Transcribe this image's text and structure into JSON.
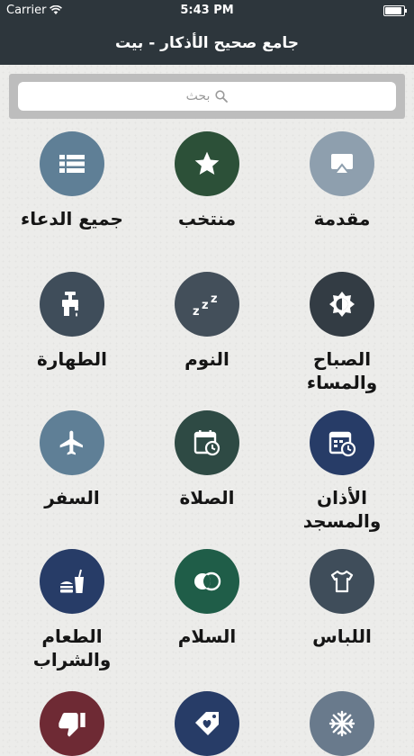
{
  "status_bar": {
    "carrier": "Carrier",
    "time": "5:43 PM",
    "battery_level": 1.0
  },
  "nav": {
    "title": "جامع صحيح الأذكار - بيت"
  },
  "search": {
    "placeholder": "بحث",
    "icon": "search-icon"
  },
  "colors": {
    "header": "#2d363c",
    "slate_light": "#5f7f96",
    "slate": "#3f4d5a",
    "green": "#2c5038",
    "navy": "#273c67",
    "teal_green": "#1f5d48",
    "maroon": "#6e2a34",
    "steel": "#697a8c"
  },
  "tiles": [
    {
      "label": "مقدمة",
      "icon": "airplay-icon",
      "color": "#8e9fae"
    },
    {
      "label": "منتخب",
      "icon": "star-icon",
      "color": "#2c5038"
    },
    {
      "label": "جميع الدعاء",
      "icon": "list-icon",
      "color": "#5f7f96"
    },
    {
      "label": "الصباح والمساء",
      "icon": "day-night-icon",
      "color": "#333c44"
    },
    {
      "label": "النوم",
      "icon": "sleep-zzz-icon",
      "color": "#434f5a"
    },
    {
      "label": "الطهارة",
      "icon": "faucet-icon",
      "color": "#3f4d5a"
    },
    {
      "label": "الأذان والمسجد",
      "icon": "calendar-schedule-icon",
      "color": "#273c67"
    },
    {
      "label": "الصلاة",
      "icon": "calendar-clock-icon",
      "color": "#2e4a44"
    },
    {
      "label": "السفر",
      "icon": "airplane-icon",
      "color": "#5f7f96"
    },
    {
      "label": "اللباس",
      "icon": "tshirt-icon",
      "color": "#3f4d5a"
    },
    {
      "label": "السلام",
      "icon": "rings-icon",
      "color": "#1f5d48"
    },
    {
      "label": "الطعام والشراب",
      "icon": "food-drink-icon",
      "color": "#273c67"
    },
    {
      "label": "",
      "icon": "snowflake-icon",
      "color": "#697a8c"
    },
    {
      "label": "",
      "icon": "tag-heart-icon",
      "color": "#273c67"
    },
    {
      "label": "",
      "icon": "thumbs-down-icon",
      "color": "#6e2a34"
    }
  ]
}
